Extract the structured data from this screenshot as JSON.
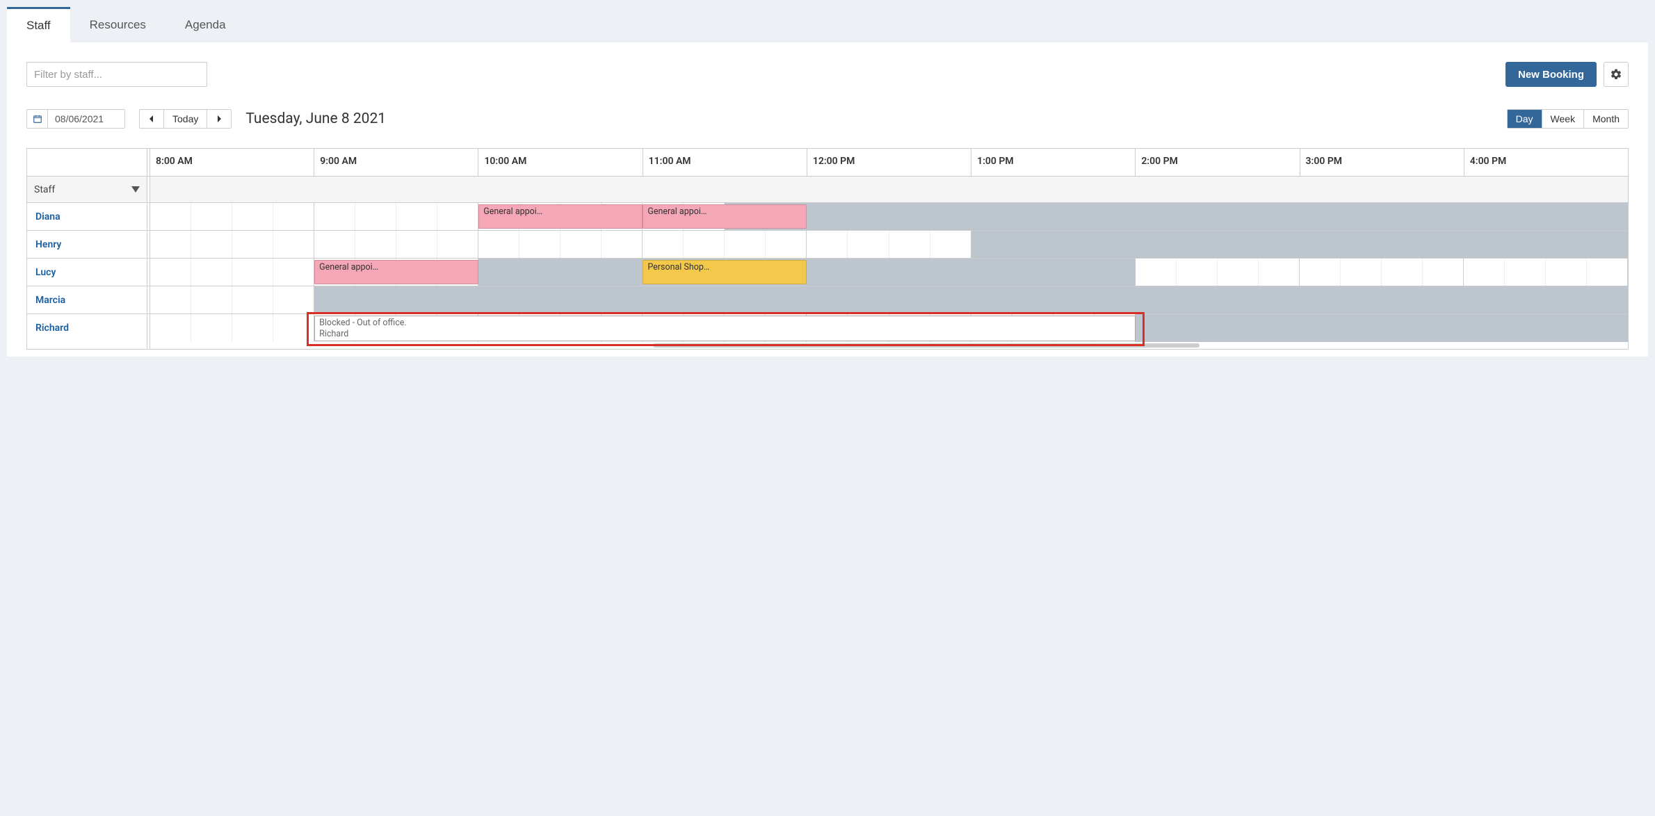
{
  "tabs": {
    "staff": "Staff",
    "resources": "Resources",
    "agenda": "Agenda"
  },
  "filter": {
    "placeholder": "Filter by staff..."
  },
  "actions": {
    "new_booking": "New Booking"
  },
  "date_picker": {
    "value": "08/06/2021"
  },
  "nav": {
    "today": "Today"
  },
  "date_title": "Tuesday, June 8 2021",
  "views": {
    "day": "Day",
    "week": "Week",
    "month": "Month"
  },
  "time_slots": [
    "8:00 AM",
    "9:00 AM",
    "10:00 AM",
    "11:00 AM",
    "12:00 PM",
    "1:00 PM",
    "2:00 PM",
    "3:00 PM",
    "4:00 PM"
  ],
  "group_label": "Staff",
  "staff": [
    {
      "name": "Diana"
    },
    {
      "name": "Henry"
    },
    {
      "name": "Lucy"
    },
    {
      "name": "Marcia"
    },
    {
      "name": "Richard"
    }
  ],
  "availability_unavailable": [
    {
      "row": 0,
      "start": "11:30",
      "end": "17:00"
    },
    {
      "row": 1,
      "start": "13:00",
      "end": "17:00"
    },
    {
      "row": 2,
      "start": "10:00",
      "end": "14:00"
    },
    {
      "row": 3,
      "start": "09:00",
      "end": "17:00"
    },
    {
      "row": 4,
      "start": "14:00",
      "end": "17:00"
    }
  ],
  "events": [
    {
      "row": 0,
      "start": "10:00",
      "end": "11:00",
      "label": "General appoi…",
      "color": "pink"
    },
    {
      "row": 0,
      "start": "11:00",
      "end": "12:00",
      "label": "General appoi…",
      "color": "pink"
    },
    {
      "row": 2,
      "start": "09:00",
      "end": "10:00",
      "label": "General appoi…",
      "color": "pink"
    },
    {
      "row": 2,
      "start": "11:00",
      "end": "12:00",
      "label": "Personal Shop…",
      "color": "yellow"
    }
  ],
  "blocked": {
    "row": 4,
    "start": "09:00",
    "end": "14:00",
    "line1": "Blocked - Out of office.",
    "line2": "Richard"
  },
  "scroll": {
    "thumb_left_pct": 34,
    "thumb_width_pct": 37
  }
}
